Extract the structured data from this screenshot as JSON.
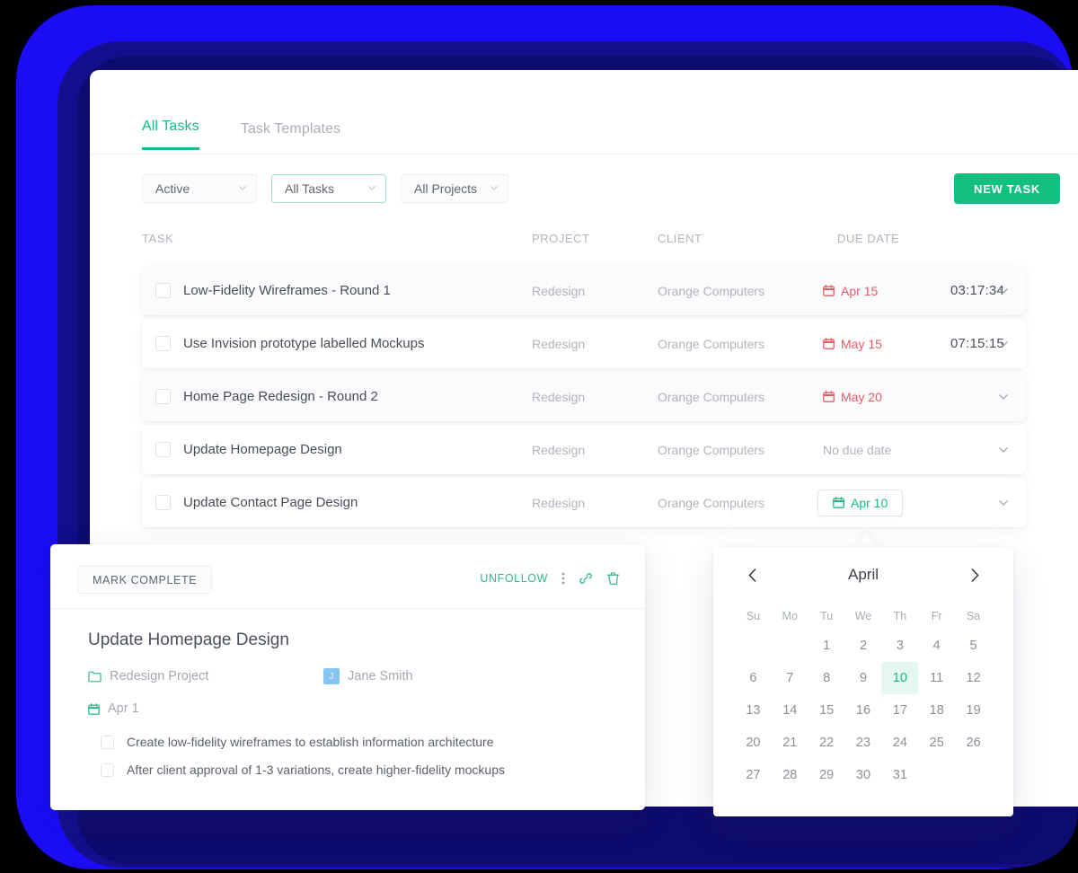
{
  "colors": {
    "accent_green": "#15bd82",
    "button_green": "#11bf81",
    "overdue_red": "#ea5a62",
    "muted_gray": "#b0b4bd",
    "avatar_blue": "#84c5f4",
    "backdrop_blue": "#1a0cf5",
    "backdrop_navy": "#0e0b6e"
  },
  "tabs": [
    {
      "label": "All Tasks",
      "active": true
    },
    {
      "label": "Task Templates",
      "active": false
    }
  ],
  "filters": [
    {
      "label": "Active",
      "icon": "chevron-down-icon"
    },
    {
      "label": "All Tasks",
      "icon": "chevron-down-icon"
    },
    {
      "label": "All Projects",
      "icon": "chevron-down-icon"
    }
  ],
  "new_task_label": "NEW TASK",
  "table": {
    "columns": [
      "TASK",
      "PROJECT",
      "CLIENT",
      "DUE DATE"
    ],
    "rows": [
      {
        "task": "Low-Fidelity Wireframes - Round 1",
        "project": "Redesign",
        "client": "Orange Computers",
        "due_date": "Apr 15",
        "due_state": "overdue",
        "timer": "03:17:34",
        "shaded": true
      },
      {
        "task": "Use Invision prototype labelled Mockups",
        "project": "Redesign",
        "client": "Orange Computers",
        "due_date": "May 15",
        "due_state": "overdue",
        "timer": "07:15:15",
        "shaded": false
      },
      {
        "task": "Home Page Redesign - Round 2",
        "project": "Redesign",
        "client": "Orange Computers",
        "due_date": "May 20",
        "due_state": "overdue",
        "timer": "",
        "shaded": true
      },
      {
        "task": "Update Homepage Design",
        "project": "Redesign",
        "client": "Orange Computers",
        "due_date": "No due date",
        "due_state": "none",
        "timer": "",
        "shaded": false
      },
      {
        "task": "Update Contact Page Design",
        "project": "Redesign",
        "client": "Orange Computers",
        "due_date": "Apr 10",
        "due_state": "editing",
        "timer": "",
        "shaded": false
      }
    ]
  },
  "detail": {
    "mark_complete_label": "MARK COMPLETE",
    "unfollow_label": "UNFOLLOW",
    "actions": [
      "more-vertical-icon",
      "link-icon",
      "trash-icon"
    ],
    "title": "Update Homepage Design",
    "project": "Redesign Project",
    "assignee": "Jane Smith",
    "assignee_initial": "J",
    "date": "Apr 1",
    "subtasks": [
      "Create low-fidelity wireframes to establish information architecture",
      "After client approval of 1-3 variations, create higher-fidelity mockups"
    ]
  },
  "calendar": {
    "month": "April",
    "prev_icon": "chevron-left-icon",
    "next_icon": "chevron-right-icon",
    "day_names": [
      "Su",
      "Mo",
      "Tu",
      "We",
      "Th",
      "Fr",
      "Sa"
    ],
    "lead_blanks": 2,
    "days": [
      1,
      2,
      3,
      4,
      5,
      6,
      7,
      8,
      9,
      10,
      11,
      12,
      13,
      14,
      15,
      16,
      17,
      18,
      19,
      20,
      21,
      22,
      23,
      24,
      25,
      26,
      27,
      28,
      29,
      30,
      31
    ],
    "selected_day": 10
  }
}
